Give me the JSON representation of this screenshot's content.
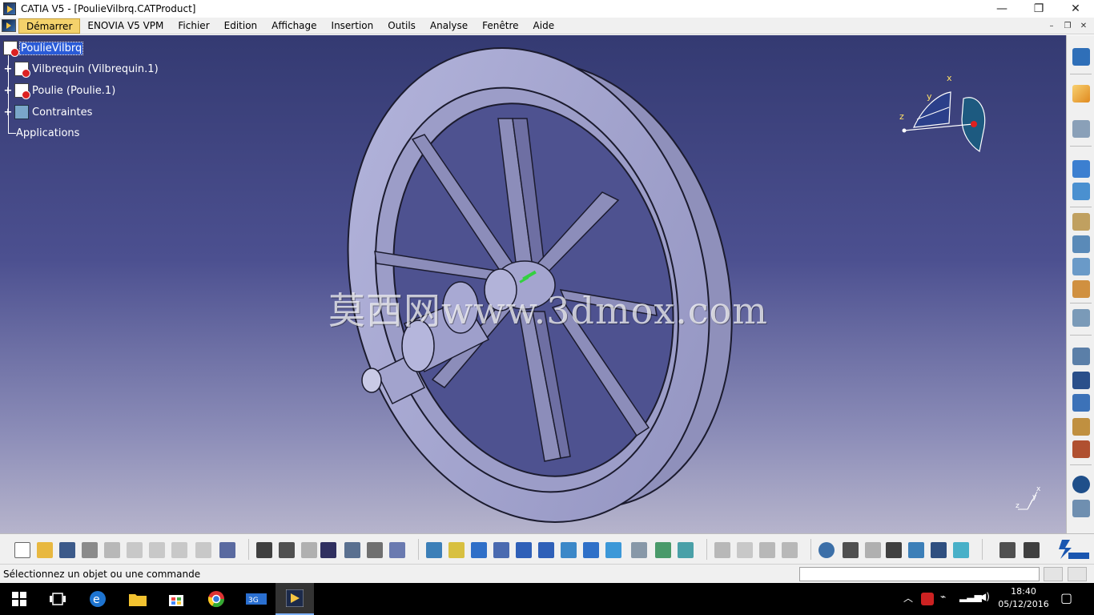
{
  "window": {
    "title": "CATIA V5 - [PoulieVilbrq.CATProduct]",
    "minimize": "—",
    "maximize": "❐",
    "close": "✕"
  },
  "menu": {
    "items": [
      "Démarrer",
      "ENOVIA V5 VPM",
      "Fichier",
      "Edition",
      "Affichage",
      "Insertion",
      "Outils",
      "Analyse",
      "Fenêtre",
      "Aide"
    ],
    "active": "Démarrer"
  },
  "mdi": {
    "minimize": "–",
    "restore": "❐",
    "close": "✕"
  },
  "tree": {
    "root": "PoulieVilbrq",
    "children": [
      "Vilbrequin (Vilbrequin.1)",
      "Poulie (Poulie.1)",
      "Contraintes"
    ],
    "applications": "Applications"
  },
  "compass": {
    "x": "x",
    "y": "y",
    "z": "z"
  },
  "watermark": "莫西网www.3dmox.com",
  "axis_glyph": {
    "x": "x",
    "y": "y",
    "z": "z"
  },
  "status": {
    "message": "Sélectionnez un objet ou une commande"
  },
  "clock": {
    "time": "18:40",
    "date": "05/12/2016"
  },
  "colors": {
    "viewport_top": "#343a72",
    "viewport_bottom": "#b6b4cc",
    "part": "#a9aad2",
    "selection": "#2a5bd7"
  }
}
